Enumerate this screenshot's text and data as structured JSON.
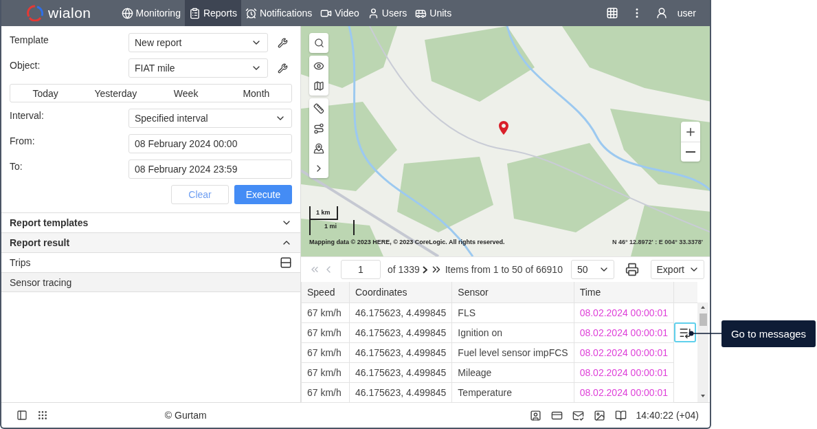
{
  "header": {
    "logo": "wialon",
    "nav": [
      {
        "label": "Monitoring",
        "selected": false
      },
      {
        "label": "Reports",
        "selected": true
      },
      {
        "label": "Notifications",
        "selected": false
      },
      {
        "label": "Video",
        "selected": false
      },
      {
        "label": "Users",
        "selected": false
      },
      {
        "label": "Units",
        "selected": false
      }
    ],
    "user": "user"
  },
  "form": {
    "template": {
      "label": "Template",
      "value": "New report"
    },
    "object": {
      "label": "Object:",
      "value": "FIAT mile"
    },
    "periods": [
      "Today",
      "Yesterday",
      "Week",
      "Month"
    ],
    "interval": {
      "label": "Interval:",
      "value": "Specified interval"
    },
    "from": {
      "label": "From:",
      "value": "08 February 2024 00:00"
    },
    "to": {
      "label": "To:",
      "value": "08 February 2024 23:59"
    },
    "buttons": {
      "clear": "Clear",
      "execute": "Execute"
    }
  },
  "sections": [
    {
      "title": "Report templates",
      "expanded": false
    },
    {
      "title": "Report result",
      "expanded": true
    }
  ],
  "results": [
    {
      "label": "Trips",
      "selected": false
    },
    {
      "label": "Sensor tracing",
      "selected": true
    }
  ],
  "map": {
    "scale_km": "1 km",
    "scale_mi": "1 mi",
    "attribution": "Mapping data © 2023 HERE, © 2023 CoreLogic. All rights reserved.",
    "coordinates": "N 46° 12.8972' : E 004° 33.3378'"
  },
  "pager": {
    "prev_disabled": true,
    "next_disabled": false,
    "page": "1",
    "of": "of 1339",
    "items": "Items from 1 to 50 of 66910",
    "per_page": "50",
    "export": "Export"
  },
  "table": {
    "columns": [
      "Speed",
      "Coordinates",
      "Sensor",
      "Time"
    ],
    "rows": [
      {
        "speed": "67 km/h",
        "coordinates": "46.175623, 4.499845",
        "sensor": "FLS",
        "time": "08.02.2024 00:00:01",
        "action": false
      },
      {
        "speed": "67 km/h",
        "coordinates": "46.175623, 4.499845",
        "sensor": "Ignition on",
        "time": "08.02.2024 00:00:01",
        "action": true
      },
      {
        "speed": "67 km/h",
        "coordinates": "46.175623, 4.499845",
        "sensor": "Fuel level sensor impFCS",
        "time": "08.02.2024 00:00:01",
        "action": false
      },
      {
        "speed": "67 km/h",
        "coordinates": "46.175623, 4.499845",
        "sensor": "Mileage",
        "time": "08.02.2024 00:00:01",
        "action": false
      },
      {
        "speed": "67 km/h",
        "coordinates": "46.175623, 4.499845",
        "sensor": "Temperature",
        "time": "08.02.2024 00:00:01",
        "action": false
      }
    ]
  },
  "callout": "Go to messages",
  "footer": {
    "copyright": "© Gurtam",
    "time": "14:40:22 (+04)"
  }
}
